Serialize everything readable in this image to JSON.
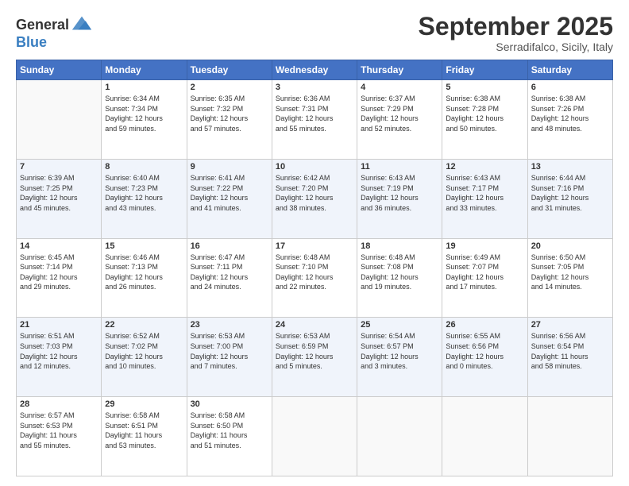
{
  "logo": {
    "general": "General",
    "blue": "Blue"
  },
  "header": {
    "month": "September 2025",
    "location": "Serradifalco, Sicily, Italy"
  },
  "weekdays": [
    "Sunday",
    "Monday",
    "Tuesday",
    "Wednesday",
    "Thursday",
    "Friday",
    "Saturday"
  ],
  "weeks": [
    [
      {
        "day": "",
        "info": ""
      },
      {
        "day": "1",
        "info": "Sunrise: 6:34 AM\nSunset: 7:34 PM\nDaylight: 12 hours\nand 59 minutes."
      },
      {
        "day": "2",
        "info": "Sunrise: 6:35 AM\nSunset: 7:32 PM\nDaylight: 12 hours\nand 57 minutes."
      },
      {
        "day": "3",
        "info": "Sunrise: 6:36 AM\nSunset: 7:31 PM\nDaylight: 12 hours\nand 55 minutes."
      },
      {
        "day": "4",
        "info": "Sunrise: 6:37 AM\nSunset: 7:29 PM\nDaylight: 12 hours\nand 52 minutes."
      },
      {
        "day": "5",
        "info": "Sunrise: 6:38 AM\nSunset: 7:28 PM\nDaylight: 12 hours\nand 50 minutes."
      },
      {
        "day": "6",
        "info": "Sunrise: 6:38 AM\nSunset: 7:26 PM\nDaylight: 12 hours\nand 48 minutes."
      }
    ],
    [
      {
        "day": "7",
        "info": "Sunrise: 6:39 AM\nSunset: 7:25 PM\nDaylight: 12 hours\nand 45 minutes."
      },
      {
        "day": "8",
        "info": "Sunrise: 6:40 AM\nSunset: 7:23 PM\nDaylight: 12 hours\nand 43 minutes."
      },
      {
        "day": "9",
        "info": "Sunrise: 6:41 AM\nSunset: 7:22 PM\nDaylight: 12 hours\nand 41 minutes."
      },
      {
        "day": "10",
        "info": "Sunrise: 6:42 AM\nSunset: 7:20 PM\nDaylight: 12 hours\nand 38 minutes."
      },
      {
        "day": "11",
        "info": "Sunrise: 6:43 AM\nSunset: 7:19 PM\nDaylight: 12 hours\nand 36 minutes."
      },
      {
        "day": "12",
        "info": "Sunrise: 6:43 AM\nSunset: 7:17 PM\nDaylight: 12 hours\nand 33 minutes."
      },
      {
        "day": "13",
        "info": "Sunrise: 6:44 AM\nSunset: 7:16 PM\nDaylight: 12 hours\nand 31 minutes."
      }
    ],
    [
      {
        "day": "14",
        "info": "Sunrise: 6:45 AM\nSunset: 7:14 PM\nDaylight: 12 hours\nand 29 minutes."
      },
      {
        "day": "15",
        "info": "Sunrise: 6:46 AM\nSunset: 7:13 PM\nDaylight: 12 hours\nand 26 minutes."
      },
      {
        "day": "16",
        "info": "Sunrise: 6:47 AM\nSunset: 7:11 PM\nDaylight: 12 hours\nand 24 minutes."
      },
      {
        "day": "17",
        "info": "Sunrise: 6:48 AM\nSunset: 7:10 PM\nDaylight: 12 hours\nand 22 minutes."
      },
      {
        "day": "18",
        "info": "Sunrise: 6:48 AM\nSunset: 7:08 PM\nDaylight: 12 hours\nand 19 minutes."
      },
      {
        "day": "19",
        "info": "Sunrise: 6:49 AM\nSunset: 7:07 PM\nDaylight: 12 hours\nand 17 minutes."
      },
      {
        "day": "20",
        "info": "Sunrise: 6:50 AM\nSunset: 7:05 PM\nDaylight: 12 hours\nand 14 minutes."
      }
    ],
    [
      {
        "day": "21",
        "info": "Sunrise: 6:51 AM\nSunset: 7:03 PM\nDaylight: 12 hours\nand 12 minutes."
      },
      {
        "day": "22",
        "info": "Sunrise: 6:52 AM\nSunset: 7:02 PM\nDaylight: 12 hours\nand 10 minutes."
      },
      {
        "day": "23",
        "info": "Sunrise: 6:53 AM\nSunset: 7:00 PM\nDaylight: 12 hours\nand 7 minutes."
      },
      {
        "day": "24",
        "info": "Sunrise: 6:53 AM\nSunset: 6:59 PM\nDaylight: 12 hours\nand 5 minutes."
      },
      {
        "day": "25",
        "info": "Sunrise: 6:54 AM\nSunset: 6:57 PM\nDaylight: 12 hours\nand 3 minutes."
      },
      {
        "day": "26",
        "info": "Sunrise: 6:55 AM\nSunset: 6:56 PM\nDaylight: 12 hours\nand 0 minutes."
      },
      {
        "day": "27",
        "info": "Sunrise: 6:56 AM\nSunset: 6:54 PM\nDaylight: 11 hours\nand 58 minutes."
      }
    ],
    [
      {
        "day": "28",
        "info": "Sunrise: 6:57 AM\nSunset: 6:53 PM\nDaylight: 11 hours\nand 55 minutes."
      },
      {
        "day": "29",
        "info": "Sunrise: 6:58 AM\nSunset: 6:51 PM\nDaylight: 11 hours\nand 53 minutes."
      },
      {
        "day": "30",
        "info": "Sunrise: 6:58 AM\nSunset: 6:50 PM\nDaylight: 11 hours\nand 51 minutes."
      },
      {
        "day": "",
        "info": ""
      },
      {
        "day": "",
        "info": ""
      },
      {
        "day": "",
        "info": ""
      },
      {
        "day": "",
        "info": ""
      }
    ]
  ]
}
